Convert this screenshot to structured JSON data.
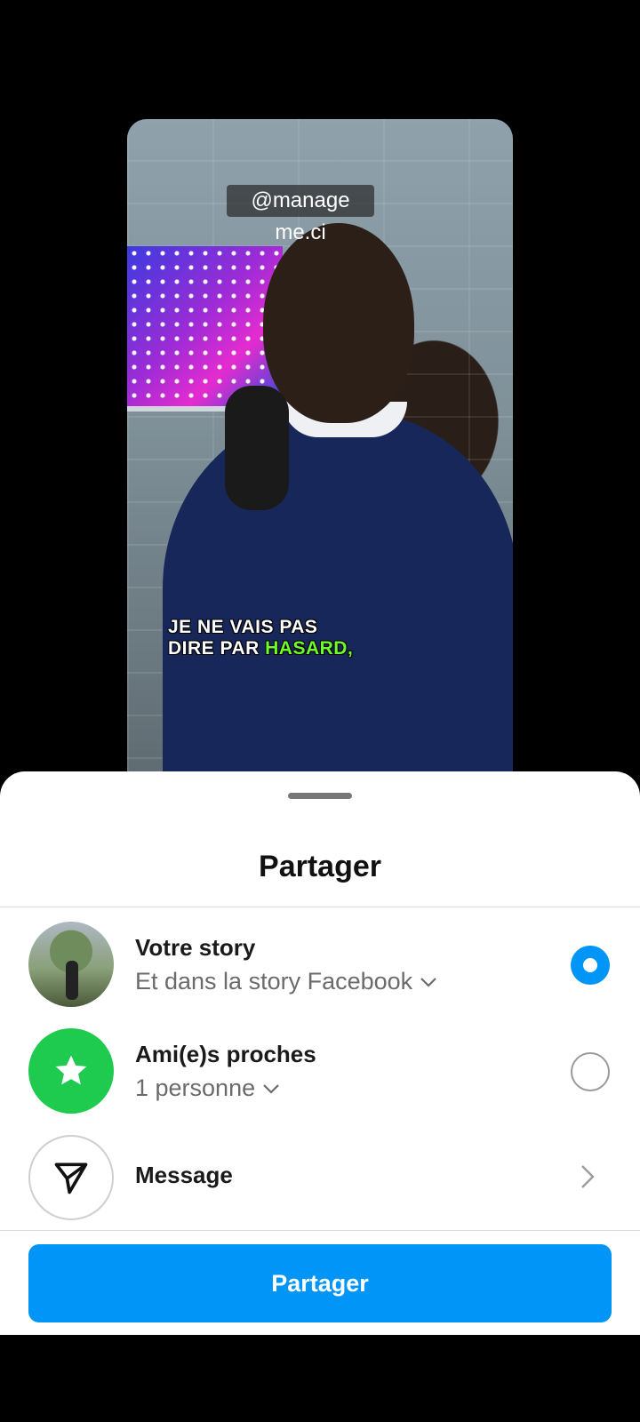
{
  "preview": {
    "watermark": "@manage me.ci",
    "caption_line1": "JE NE VAIS PAS",
    "caption_line2_prefix": "DIRE PAR ",
    "caption_line2_highlight": "HASARD,"
  },
  "sheet": {
    "title": "Partager",
    "options": [
      {
        "title": "Votre story",
        "subtitle": "Et dans la story Facebook",
        "selected": true
      },
      {
        "title": "Ami(e)s proches",
        "subtitle": "1 personne",
        "selected": false
      },
      {
        "title": "Message"
      }
    ],
    "share_button": "Partager"
  },
  "colors": {
    "accent": "#0095f6",
    "close_friends": "#1fcb4f",
    "caption_highlight": "#6dff2b"
  },
  "icons": {
    "close_friends": "star-icon",
    "message": "paper-plane-icon",
    "dropdown": "chevron-down-icon",
    "navigate": "chevron-right-icon"
  }
}
